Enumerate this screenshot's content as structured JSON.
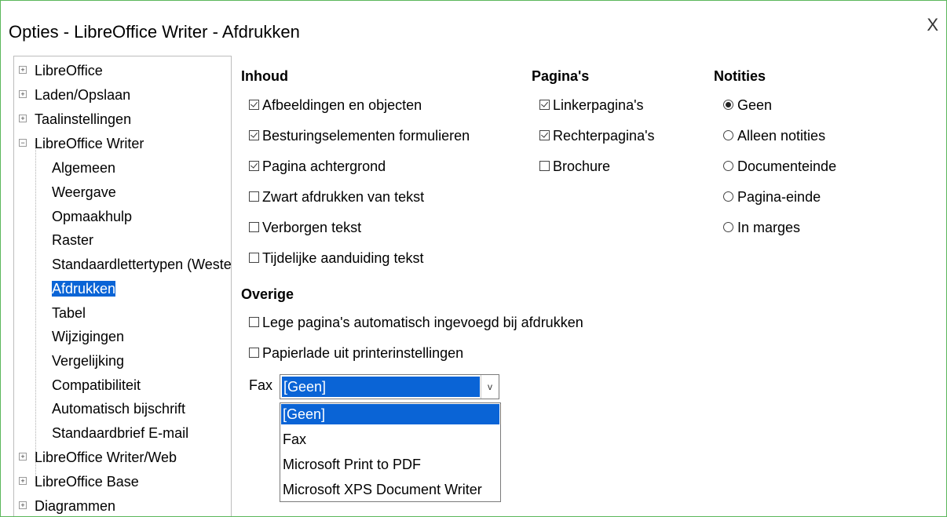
{
  "window": {
    "title": "Opties - LibreOffice Writer - Afdrukken",
    "close_glyph": "X"
  },
  "tree": {
    "top_items": [
      {
        "label": "LibreOffice",
        "expander": "+"
      },
      {
        "label": "Laden/Opslaan",
        "expander": "+"
      },
      {
        "label": "Taalinstellingen",
        "expander": "+"
      },
      {
        "label": "LibreOffice Writer",
        "expander": "−"
      },
      {
        "label": "LibreOffice Writer/Web",
        "expander": "+"
      },
      {
        "label": "LibreOffice Base",
        "expander": "+"
      },
      {
        "label": "Diagrammen",
        "expander": "+"
      }
    ],
    "writer_children": [
      "Algemeen",
      "Weergave",
      "Opmaakhulp",
      "Raster",
      "Standaardlettertypen (Weste",
      "Afdrukken",
      "Tabel",
      "Wijzigingen",
      "Vergelijking",
      "Compatibiliteit",
      "Automatisch bijschrift",
      "Standaardbrief E-mail"
    ],
    "selected": "Afdrukken"
  },
  "inhoud": {
    "heading": "Inhoud",
    "options": [
      {
        "label": "Afbeeldingen en objecten",
        "checked": true
      },
      {
        "label": "Besturingselementen formulieren",
        "checked": true
      },
      {
        "label": "Pagina achtergrond",
        "checked": true
      },
      {
        "label": "Zwart afdrukken van tekst",
        "checked": false
      },
      {
        "label": "Verborgen tekst",
        "checked": false
      },
      {
        "label": "Tijdelijke aanduiding tekst",
        "checked": false
      }
    ]
  },
  "paginas": {
    "heading": "Pagina's",
    "options": [
      {
        "label": "Linkerpagina's",
        "checked": true
      },
      {
        "label": "Rechterpagina's",
        "checked": true
      },
      {
        "label": "Brochure",
        "checked": false
      }
    ]
  },
  "notities": {
    "heading": "Notities",
    "options": [
      {
        "label": "Geen",
        "selected": true
      },
      {
        "label": "Alleen notities",
        "selected": false
      },
      {
        "label": "Documenteinde",
        "selected": false
      },
      {
        "label": "Pagina-einde",
        "selected": false
      },
      {
        "label": "In marges",
        "selected": false
      }
    ]
  },
  "overige": {
    "heading": "Overige",
    "options": [
      {
        "label": "Lege pagina's automatisch ingevoegd bij afdrukken",
        "checked": false
      },
      {
        "label": "Papierlade uit printerinstellingen",
        "checked": false
      }
    ]
  },
  "fax": {
    "label": "Fax",
    "value": "[Geen]",
    "dropdown_glyph": "v",
    "options": [
      "[Geen]",
      "Fax",
      "Microsoft Print to PDF",
      "Microsoft XPS Document Writer"
    ],
    "highlighted": "[Geen]"
  },
  "colors": {
    "selection": "#0a64d6",
    "window_border": "#5bb75b"
  }
}
